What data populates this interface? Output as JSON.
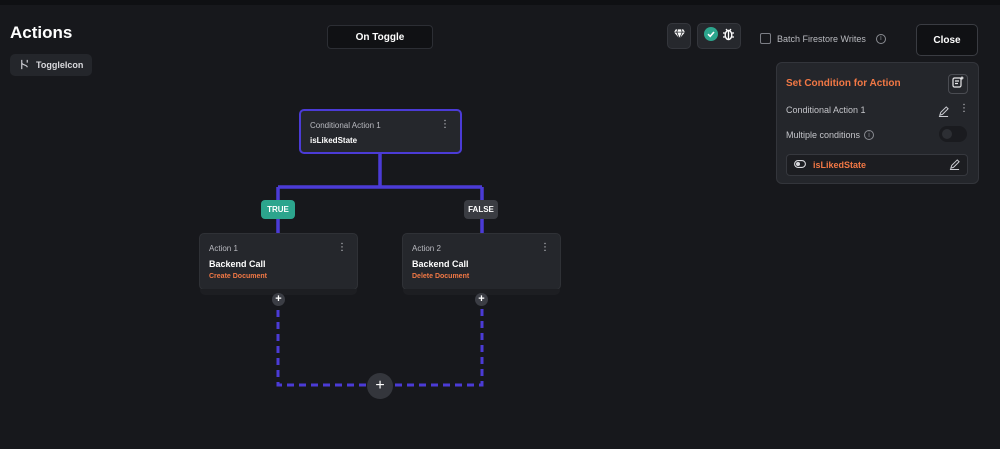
{
  "header": {
    "title": "Actions",
    "widget_chip": {
      "label": "ToggleIcon",
      "icon": "tree-branch-icon"
    },
    "trigger_label": "On Toggle",
    "batch_label": "Batch Firestore Writes",
    "close_label": "Close"
  },
  "toolbar_icons": [
    "gem-icon",
    "check-circle-icon",
    "bug-icon"
  ],
  "panel": {
    "title": "Set Condition for Action",
    "condition_name": "Conditional Action 1",
    "multiple_label": "Multiple conditions",
    "condition_value": "isLikedState"
  },
  "flow": {
    "condition_node": {
      "label": "Conditional Action 1",
      "name": "isLikedState"
    },
    "true_label": "TRUE",
    "false_label": "FALSE",
    "actions": [
      {
        "label": "Action 1",
        "name": "Backend Call",
        "sub": "Create Document"
      },
      {
        "label": "Action 2",
        "name": "Backend Call",
        "sub": "Delete Document"
      }
    ]
  },
  "colors": {
    "accent_orange": "#f27845",
    "accent_purple": "#4b3bd6",
    "true_green": "#2ca58d",
    "background": "#17181c"
  }
}
